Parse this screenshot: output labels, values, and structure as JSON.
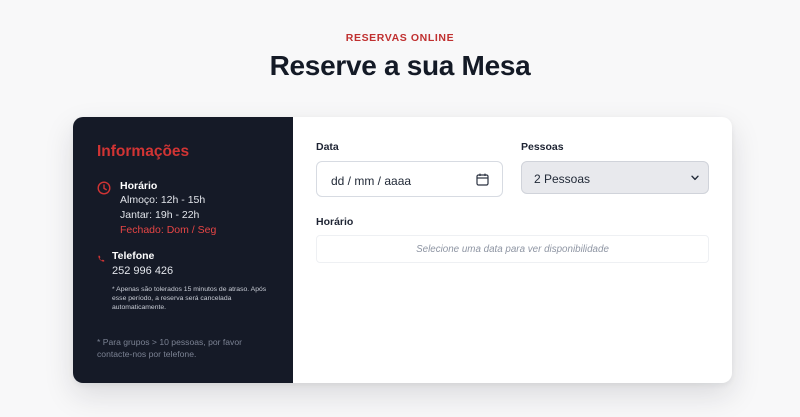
{
  "header": {
    "eyebrow": "RESERVAS ONLINE",
    "title": "Reserve a sua Mesa"
  },
  "info": {
    "title": "Informações",
    "hours": {
      "icon": "clock-icon",
      "label": "Horário",
      "lunch": "Almoço: 12h - 15h",
      "dinner": "Jantar: 19h - 22h",
      "closed": "Fechado: Dom / Seg"
    },
    "phone": {
      "icon": "phone-icon",
      "label": "Telefone",
      "number": "252 996 426",
      "note": "* Apenas são tolerados 15 minutos de atraso. Após esse período, a reserva será cancelada automaticamente."
    },
    "group_note": "* Para grupos > 10 pessoas, por favor contacte-nos por telefone."
  },
  "form": {
    "date_label": "Data",
    "date_placeholder": "dd / mm / aaaa",
    "date_icon": "calendar-icon",
    "people_label": "Pessoas",
    "people_selected": "2 Pessoas",
    "time_label": "Horário",
    "time_placeholder": "Selecione uma data para ver disponibilidade"
  },
  "colors": {
    "accent": "#d13434",
    "panel_bg": "#151a27",
    "page_bg": "#f8f8f9",
    "heading": "#141a26"
  }
}
